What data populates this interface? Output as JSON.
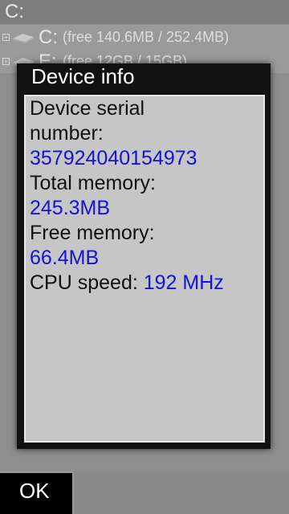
{
  "background": {
    "path": "C:",
    "drives": [
      {
        "letter": "C:",
        "info": "(free 140.6MB / 252.4MB)"
      },
      {
        "letter": "E:",
        "info": "(free 12GB / 15GB)"
      }
    ]
  },
  "dialog": {
    "title": "Device info",
    "serial_label_1": "Device serial",
    "serial_label_2": "number:",
    "serial_value": "357924040154973",
    "total_memory_label": "Total memory:",
    "total_memory_value": "245.3MB",
    "free_memory_label": "Free memory:",
    "free_memory_value": "66.4MB",
    "cpu_label": "CPU speed:",
    "cpu_value": "192 MHz"
  },
  "softkeys": {
    "ok_label": "OK"
  },
  "colors": {
    "value_text": "#1414d0",
    "label_text": "#111111",
    "dialog_frame": "#111111"
  }
}
